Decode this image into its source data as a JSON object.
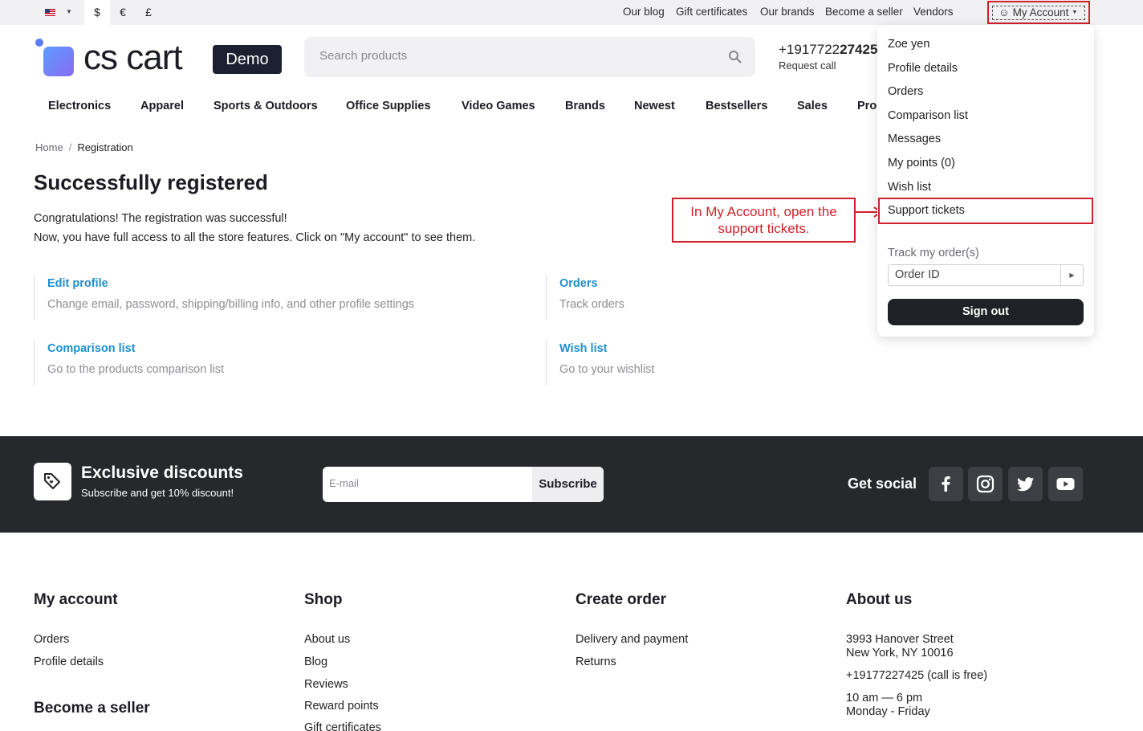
{
  "topbar": {
    "currencies": [
      "$",
      "€",
      "£"
    ],
    "links": [
      "Our blog",
      "Gift certificates",
      "Our brands",
      "Become a seller",
      "Vendors"
    ],
    "account_label": "My Account"
  },
  "header": {
    "logo_text": "cs cart",
    "logo_badge": "Demo",
    "search_placeholder": "Search products",
    "phone_prefix": "+1917722",
    "phone_bold": "27425",
    "request_call": "Request call"
  },
  "nav": [
    "Electronics",
    "Apparel",
    "Sports & Outdoors",
    "Office Supplies",
    "Video Games",
    "Brands",
    "Newest",
    "Bestsellers",
    "Sales",
    "Pro"
  ],
  "breadcrumb": {
    "home": "Home",
    "sep": "/",
    "current": "Registration"
  },
  "main": {
    "title": "Successfully registered",
    "line1": "Congratulations! The registration was successful!",
    "line2": "Now, you have full access to all the store features. Click on \"My account\" to see them.",
    "cards": [
      {
        "title": "Edit profile",
        "desc": "Change email, password, shipping/billing info, and other profile settings"
      },
      {
        "title": "Orders",
        "desc": "Track orders"
      },
      {
        "title": "Comparison list",
        "desc": "Go to the products comparison list"
      },
      {
        "title": "Wish list",
        "desc": "Go to your wishlist"
      }
    ]
  },
  "annotation": "In My Account, open the support tickets.",
  "dropdown": {
    "items": [
      "Zoe yen",
      "Profile details",
      "Orders",
      "Comparison list",
      "Messages",
      "My points (0)",
      "Wish list",
      "Support tickets"
    ],
    "track_label": "Track my order(s)",
    "order_placeholder": "Order ID",
    "signout": "Sign out"
  },
  "band": {
    "title": "Exclusive discounts",
    "subtitle": "Subscribe and get 10% discount!",
    "email_placeholder": "E-mail",
    "subscribe": "Subscribe",
    "get_social": "Get social"
  },
  "footer": {
    "my_account": {
      "title": "My account",
      "links": [
        "Orders",
        "Profile details"
      ]
    },
    "become_seller": "Become a seller",
    "shop": {
      "title": "Shop",
      "links": [
        "About us",
        "Blog",
        "Reviews",
        "Reward points",
        "Gift certificates"
      ]
    },
    "create_order": {
      "title": "Create order",
      "links": [
        "Delivery and payment",
        "Returns"
      ]
    },
    "about": {
      "title": "About us",
      "address1": "3993 Hanover Street",
      "address2": "New York, NY 10016",
      "phone": "+19177227425 (call is free)",
      "hours1": "10 am — 6 pm",
      "hours2": "Monday - Friday"
    }
  },
  "colors": {
    "accent_red": "#d1202c",
    "link_blue": "#1e8fd0",
    "band_bg": "#26282c"
  }
}
